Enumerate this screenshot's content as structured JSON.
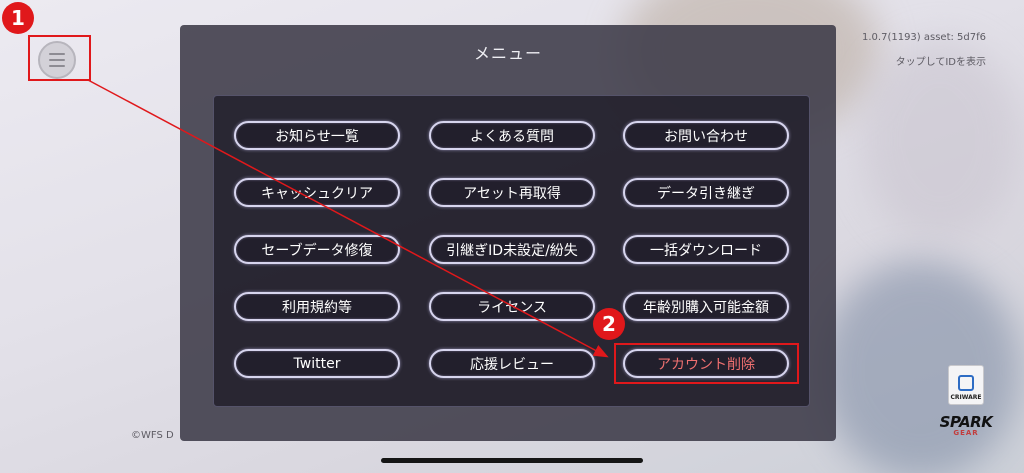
{
  "menu": {
    "title": "メニュー",
    "buttons": [
      "お知らせ一覧",
      "よくある質問",
      "お問い合わせ",
      "キャッシュクリア",
      "アセット再取得",
      "データ引き継ぎ",
      "セーブデータ修復",
      "引継ぎID未設定/紛失",
      "一括ダウンロード",
      "利用規約等",
      "ライセンス",
      "年齢別購入可能金額",
      "Twitter",
      "応援レビュー",
      "アカウント削除"
    ]
  },
  "version": "1.0.7(1193) asset: 5d7f6",
  "id_hint": "タップしてIDを表示",
  "copyright": "©WFS D",
  "annotations": {
    "step1": "1",
    "step2": "2"
  },
  "logos": {
    "criware": "CRIWARE",
    "spark_top": "SPARK",
    "spark_bottom": "GEAR"
  },
  "colors": {
    "highlight": "#e0181b",
    "danger_text": "#f07070"
  },
  "icons": {
    "menu": "hamburger-menu-icon"
  }
}
